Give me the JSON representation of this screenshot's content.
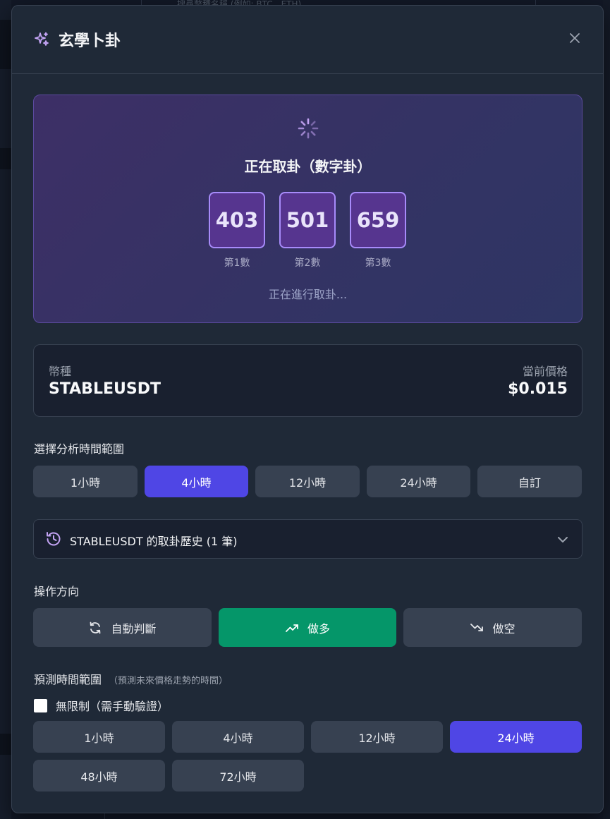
{
  "background": {
    "search_placeholder": "搜尋幣種名稱 (例如: BTC、ETH)"
  },
  "modal": {
    "title": "玄學卜卦",
    "icon": "sparkles-icon",
    "close_icon": "close-icon"
  },
  "divination": {
    "status": "正在取卦（數字卦）",
    "numbers": [
      {
        "value": "403",
        "label": "第1數"
      },
      {
        "value": "501",
        "label": "第2數"
      },
      {
        "value": "659",
        "label": "第3數"
      }
    ],
    "progress_text": "正在進行取卦..."
  },
  "coin": {
    "symbol_label": "幣種",
    "symbol": "STABLEUSDT",
    "price_label": "當前價格",
    "price": "$0.015"
  },
  "analysis_range": {
    "label": "選擇分析時間範圍",
    "options": [
      "1小時",
      "4小時",
      "12小時",
      "24小時",
      "自訂"
    ],
    "selected": "4小時"
  },
  "history": {
    "text": "STABLEUSDT 的取卦歷史 (1 筆)"
  },
  "direction": {
    "label": "操作方向",
    "options": [
      {
        "label": "自動判斷",
        "icon": "refresh-icon"
      },
      {
        "label": "做多",
        "icon": "trending-up-icon"
      },
      {
        "label": "做空",
        "icon": "trending-down-icon"
      }
    ],
    "selected": "做多"
  },
  "prediction_range": {
    "label": "預測時間範圍",
    "sublabel": "（預測未來價格走勢的時間）",
    "unlimited_label": "無限制（需手動驗證）",
    "unlimited_checked": false,
    "options": [
      "1小時",
      "4小時",
      "12小時",
      "24小時",
      "48小時",
      "72小時"
    ],
    "selected": "24小時"
  },
  "colors": {
    "accent": "#4f46e5",
    "long": "#059669",
    "purple": "#a78bfa"
  }
}
